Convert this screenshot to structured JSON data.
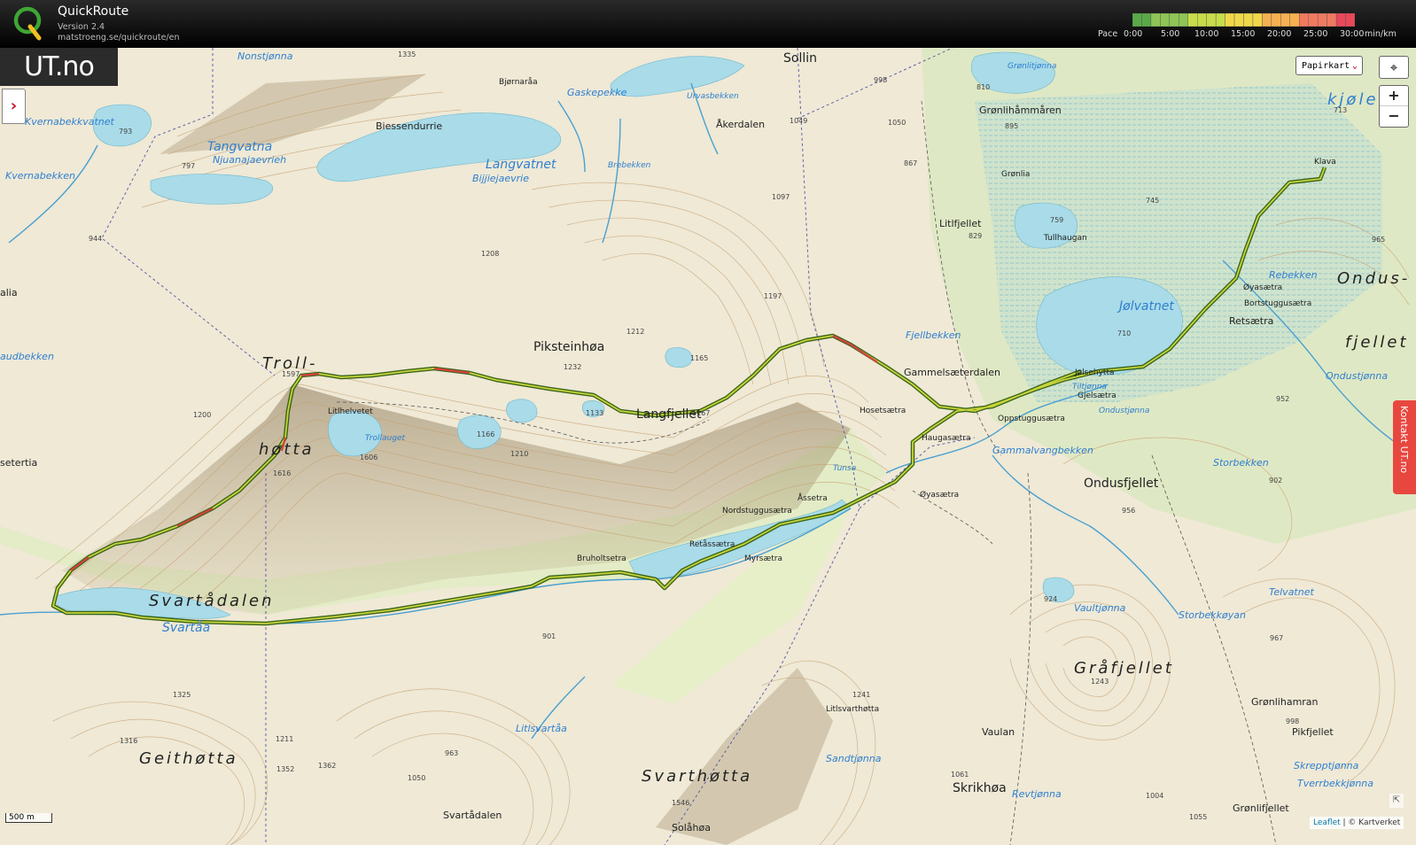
{
  "header": {
    "app_title": "QuickRoute",
    "version": "Version 2.4",
    "url": "matstroeng.se/quickroute/en",
    "pace_label": "Pace",
    "pace_ticks": [
      "0:00",
      "5:00",
      "10:00",
      "15:00",
      "20:00",
      "25:00",
      "30:00"
    ],
    "pace_unit": "min/km",
    "pace_colors": [
      "#5aa84a",
      "#8fc456",
      "#c8dc4a",
      "#f0d84a",
      "#f5b050",
      "#f07a60",
      "#e8485a"
    ]
  },
  "map": {
    "logo_text": "UT.no",
    "sidebar_toggle": "›",
    "map_type": "Papirkart",
    "zoom_in": "+",
    "zoom_out": "−",
    "contact_tab": "Kontakt UT.no",
    "scale_label": "500 m",
    "attribution_leaflet": "Leaflet",
    "attribution_rest": "| © Kartverket",
    "route_color_fast": "#3a7a1a",
    "route_color_slow": "#d84040",
    "water_color": "#a9dbe8",
    "place_names": [
      {
        "t": "Nonstjønna",
        "w": 1
      },
      {
        "t": "1335",
        "h": 1
      },
      {
        "t": "Bjørnaråa"
      },
      {
        "t": "Gaskepekke",
        "w": 1
      },
      {
        "t": "Sollin"
      },
      {
        "t": "998",
        "h": 1
      },
      {
        "t": "Grønlitjønna",
        "w": 1
      },
      {
        "t": "Grønlihåmmåren"
      },
      {
        "t": "Kvernabekkvatnet",
        "w": 1
      },
      {
        "t": "Biessendurrie"
      },
      {
        "t": "Tangvatna",
        "w": 1
      },
      {
        "t": "Njuanajaevrieh",
        "w": 1
      },
      {
        "t": "Langvatnet",
        "w": 1
      },
      {
        "t": "Bijjiejaevrie",
        "w": 1
      },
      {
        "t": "Åkerdalen"
      },
      {
        "t": "Urvasbekken",
        "w": 1
      },
      {
        "t": "Grønlia"
      },
      {
        "t": "Kvernabekken",
        "w": 1
      },
      {
        "t": "Brebekken",
        "w": 1
      },
      {
        "t": "Litlfjellet"
      },
      {
        "t": "Tullhaugan"
      },
      {
        "t": "Klava"
      },
      {
        "t": "kjølen",
        "w": 1
      },
      {
        "t": "Ondus-"
      },
      {
        "t": "fjellet"
      },
      {
        "t": "Øyasætra"
      },
      {
        "t": "Bortstuggusætra"
      },
      {
        "t": "Retsætra"
      },
      {
        "t": "Jølvatnet",
        "w": 1
      },
      {
        "t": "Rebekken",
        "w": 1
      },
      {
        "t": "Ondustjønna",
        "w": 1
      },
      {
        "t": "Troll-"
      },
      {
        "t": "høtta"
      },
      {
        "t": "Piksteinhøa"
      },
      {
        "t": "Langfjellet"
      },
      {
        "t": "Litlhelvetet"
      },
      {
        "t": "Trollauget",
        "w": 1
      },
      {
        "t": "Fjellbekken",
        "w": 1
      },
      {
        "t": "Gammelsæterdalen"
      },
      {
        "t": "Jølsehytta"
      },
      {
        "t": "Tiltjønna",
        "w": 1
      },
      {
        "t": "Gjelsætra"
      },
      {
        "t": "Hosetsætra"
      },
      {
        "t": "Oppstuggusætra"
      },
      {
        "t": "Ondustjønna",
        "w": 1
      },
      {
        "t": "Haugasætra"
      },
      {
        "t": "Gammalvangbekken",
        "w": 1
      },
      {
        "t": "Storbekken",
        "w": 1
      },
      {
        "t": "Ondusfjellet"
      },
      {
        "t": "Øyasætra"
      },
      {
        "t": "Åssetra"
      },
      {
        "t": "Nordstuggusætra"
      },
      {
        "t": "Retåssætra"
      },
      {
        "t": "Myrsætra"
      },
      {
        "t": "Bruholtsetra"
      },
      {
        "t": "Svartådalen"
      },
      {
        "t": "Svartåa",
        "w": 1
      },
      {
        "t": "Tunsa",
        "w": 1
      },
      {
        "t": "Vaultjønna",
        "w": 1
      },
      {
        "t": "Storbekkøyan",
        "w": 1
      },
      {
        "t": "Telvatnet",
        "w": 1
      },
      {
        "t": "Gråfjellet"
      },
      {
        "t": "Litlsvartåa",
        "w": 1
      },
      {
        "t": "Litlsvarthøtta"
      },
      {
        "t": "Grønlihamran"
      },
      {
        "t": "Geithøtta"
      },
      {
        "t": "Vaulan"
      },
      {
        "t": "Pikfjellet"
      },
      {
        "t": "Sandtjønna",
        "w": 1
      },
      {
        "t": "Skrepptjønna",
        "w": 1
      },
      {
        "t": "Tverrbekkjønna",
        "w": 1
      },
      {
        "t": "Svarthøtta"
      },
      {
        "t": "Skrikhøa"
      },
      {
        "t": "Revtjønna",
        "w": 1
      },
      {
        "t": "Grønlifjellet"
      },
      {
        "t": "Svartådalen"
      },
      {
        "t": "Solåhøa"
      },
      {
        "t": "alia"
      },
      {
        "t": "setertia"
      },
      {
        "t": "audbekken",
        "w": 1
      },
      {
        "t": "1200",
        "h": 1
      },
      {
        "t": "1212",
        "h": 1
      },
      {
        "t": "1197",
        "h": 1
      },
      {
        "t": "1097",
        "h": 1
      },
      {
        "t": "1208",
        "h": 1
      },
      {
        "t": "1232",
        "h": 1
      },
      {
        "t": "1165",
        "h": 1
      },
      {
        "t": "1167",
        "h": 1
      },
      {
        "t": "1133",
        "h": 1
      },
      {
        "t": "1166",
        "h": 1
      },
      {
        "t": "1210",
        "h": 1
      },
      {
        "t": "1606",
        "h": 1
      },
      {
        "t": "1616",
        "h": 1
      },
      {
        "t": "1597",
        "h": 1
      },
      {
        "t": "1049",
        "h": 1
      },
      {
        "t": "895",
        "h": 1
      },
      {
        "t": "867",
        "h": 1
      },
      {
        "t": "829",
        "h": 1
      },
      {
        "t": "759",
        "h": 1
      },
      {
        "t": "745",
        "h": 1
      },
      {
        "t": "713",
        "h": 1
      },
      {
        "t": "710",
        "h": 1
      },
      {
        "t": "965",
        "h": 1
      },
      {
        "t": "952",
        "h": 1
      },
      {
        "t": "902",
        "h": 1
      },
      {
        "t": "956",
        "h": 1
      },
      {
        "t": "924",
        "h": 1
      },
      {
        "t": "967",
        "h": 1
      },
      {
        "t": "1243",
        "h": 1
      },
      {
        "t": "998",
        "h": 1
      },
      {
        "t": "1241",
        "h": 1
      },
      {
        "t": "1061",
        "h": 1
      },
      {
        "t": "1004",
        "h": 1
      },
      {
        "t": "1055",
        "h": 1
      },
      {
        "t": "793",
        "h": 1
      },
      {
        "t": "797",
        "h": 1
      },
      {
        "t": "944",
        "h": 1
      },
      {
        "t": "901",
        "h": 1
      },
      {
        "t": "963",
        "h": 1
      },
      {
        "t": "1325",
        "h": 1
      },
      {
        "t": "1316",
        "h": 1
      },
      {
        "t": "1211",
        "h": 1
      },
      {
        "t": "1352",
        "h": 1
      },
      {
        "t": "1362",
        "h": 1
      },
      {
        "t": "1546",
        "h": 1
      },
      {
        "t": "1050",
        "h": 1
      },
      {
        "t": "810",
        "h": 1
      },
      {
        "t": "1050",
        "h": 1
      }
    ]
  }
}
